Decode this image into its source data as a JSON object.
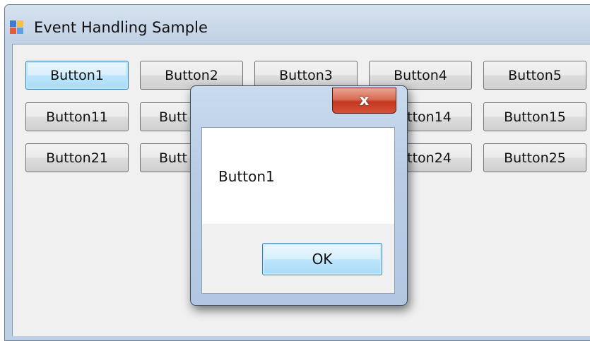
{
  "window": {
    "title": "Event Handling Sample",
    "icon": "windows-form-icon"
  },
  "buttons": [
    [
      "Button1",
      "Button2",
      "Button3",
      "Button4",
      "Button5"
    ],
    [
      "Button11",
      "Butt",
      "Button14",
      "Button15"
    ],
    [
      "Button21",
      "Butt",
      "Button24",
      "Button25"
    ]
  ],
  "dialog": {
    "close_label": "x",
    "message": "Button1",
    "ok_label": "OK"
  },
  "colors": {
    "client_background": "#f0f0f0",
    "focus_border": "#3c7fb1",
    "close_button": "#c3381f"
  }
}
